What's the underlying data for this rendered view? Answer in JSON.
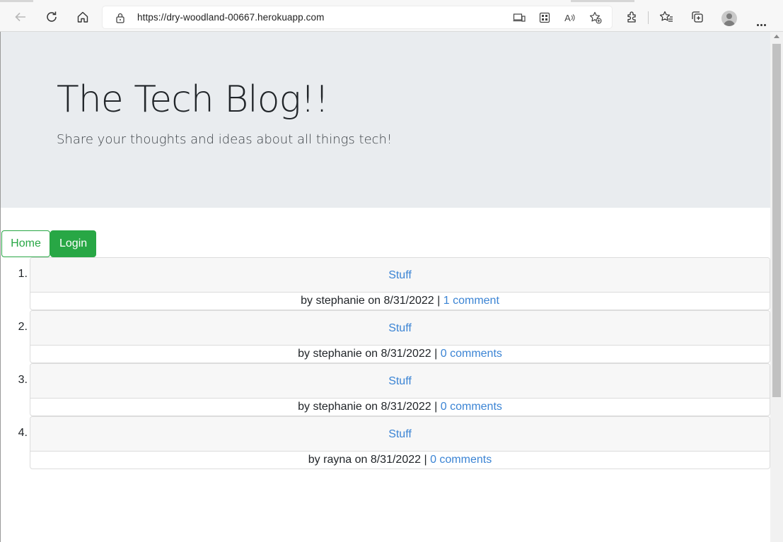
{
  "browser": {
    "url": "https://dry-woodland-00667.herokuapp.com",
    "read_aloud_label": "A",
    "icons": [
      "back-icon",
      "refresh-icon",
      "home-icon",
      "lock-icon",
      "app-available-icon",
      "qr-icon",
      "read-aloud-icon",
      "add-favorite-icon",
      "extensions-icon",
      "favorites-icon",
      "collections-icon",
      "profile-avatar",
      "more-icon"
    ]
  },
  "header": {
    "title": "The Tech Blog!!",
    "subtitle": "Share your thoughts and ideas about all things tech!"
  },
  "nav": {
    "home_label": "Home",
    "login_label": "Login"
  },
  "posts": [
    {
      "number": "1.",
      "title": "Stuff",
      "byline_prefix": "by stephanie on 8/31/2022 | ",
      "comments": "1 comment"
    },
    {
      "number": "2.",
      "title": "Stuff",
      "byline_prefix": "by stephanie on 8/31/2022 | ",
      "comments": "0 comments"
    },
    {
      "number": "3.",
      "title": "Stuff",
      "byline_prefix": "by stephanie on 8/31/2022 | ",
      "comments": "0 comments"
    },
    {
      "number": "4.",
      "title": "Stuff",
      "byline_prefix": "by rayna on 8/31/2022 | ",
      "comments": "0 comments"
    }
  ],
  "colors": {
    "accent_green": "#28a745",
    "link_blue": "#3b84d4",
    "jumbotron_bg": "#e9ecef"
  }
}
